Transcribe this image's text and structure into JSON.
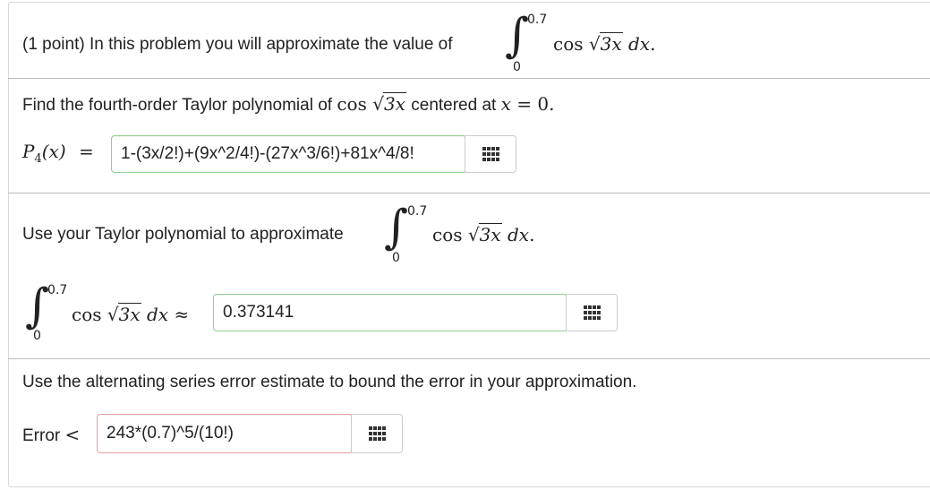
{
  "intro": {
    "text": "(1 point) In this problem you will approximate the value of",
    "integral": {
      "upper": "0.7",
      "lower": "0",
      "integrand_fn": "cos",
      "radicand": "3x",
      "differential": "dx",
      "end": "."
    }
  },
  "part1": {
    "text_before": "Find the fourth-order Taylor polynomial of",
    "fn": "cos",
    "radicand": "3x",
    "text_after": "centered at",
    "var": "x",
    "eq": "=",
    "center": "0.",
    "label_P": "P",
    "label_sub": "4",
    "label_arg": "(x)",
    "label_eq": "=",
    "answer": "1-(3x/2!)+(9x^2/4!)-(27x^3/6!)+81x^4/8!"
  },
  "part2": {
    "text": "Use your Taylor polynomial to approximate",
    "integral": {
      "upper": "0.7",
      "lower": "0",
      "integrand_fn": "cos",
      "radicand": "3x",
      "differential": "dx",
      "end": "."
    },
    "approx_sym": "≈",
    "answer": "0.373141"
  },
  "part3": {
    "text": "Use the alternating series error estimate to bound the error in your approximation.",
    "label": "Error",
    "lt": "<",
    "answer": "243*(0.7)^5/(10!)"
  },
  "colors": {
    "correct_border": "#8fcf8f",
    "incorrect_border": "#e7a0a0"
  },
  "icons": {
    "palette": "equation-editor-grid-icon"
  }
}
